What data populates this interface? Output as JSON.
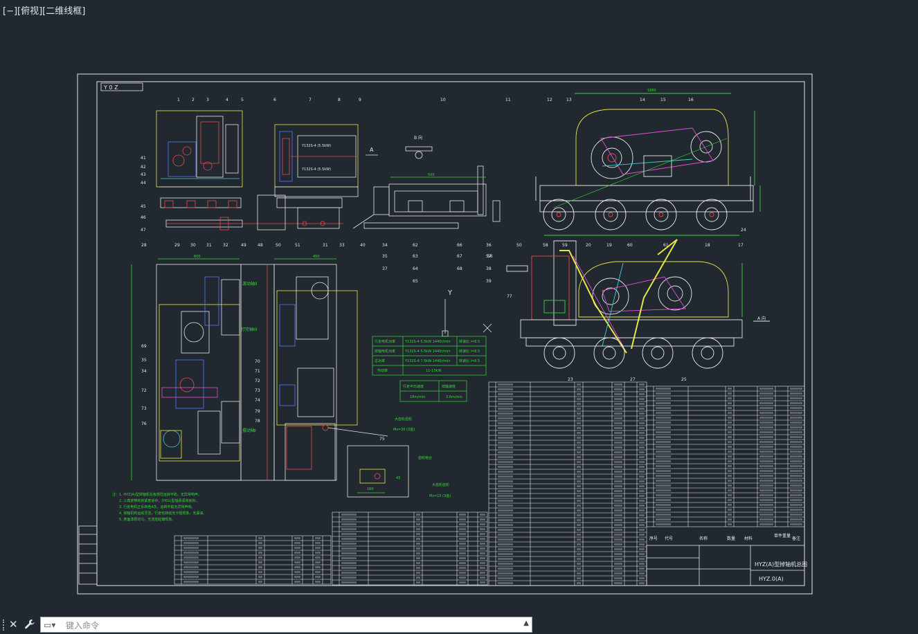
{
  "viewport": {
    "label": "[−][俯视][二维线框]",
    "background": "#212830"
  },
  "drawing": {
    "title": "HYZ(A)型掉轴机总图",
    "drawing_no": "HYZ.0(A)",
    "view_labels": {
      "top_left": "Y 0 Z",
      "section_b": "B 向",
      "view_a": "A 向",
      "view_a_arrow": "A"
    },
    "dims": {
      "d1": "575",
      "d2": "500",
      "d3": "1860",
      "d4": "120",
      "d5": "530",
      "d6": "188",
      "d7": "325",
      "d8": "710",
      "d9": "370",
      "d10": "600",
      "d11": "450",
      "d12": "1490",
      "d13": "160",
      "d14": "43",
      "d15": "800",
      "d16": "2540",
      "d17": "400"
    },
    "callouts_top": [
      "1",
      "2",
      "3",
      "4",
      "5",
      "6",
      "7",
      "8",
      "9",
      "10",
      "11",
      "12",
      "13",
      "14",
      "15",
      "16"
    ],
    "callouts_left": [
      "41",
      "42",
      "43",
      "44",
      "45",
      "46",
      "47"
    ],
    "callouts_bottom": [
      "28",
      "29",
      "30",
      "31",
      "32",
      "49",
      "48",
      "50",
      "51",
      "31",
      "33",
      "40",
      "34",
      "35",
      "37"
    ],
    "callouts_mid": [
      "62",
      "63",
      "64",
      "65",
      "66",
      "67",
      "68",
      "36",
      "57",
      "38",
      "39",
      "58",
      "59",
      "20",
      "19",
      "60",
      "61",
      "18",
      "17"
    ],
    "callouts_lower_left": [
      "69",
      "35",
      "34",
      "72",
      "73",
      "76"
    ],
    "callouts_lower_mid": [
      "70",
      "71",
      "72",
      "73",
      "74",
      "75",
      "79",
      "78"
    ],
    "callouts_right_lower": [
      "77",
      "50",
      "56",
      "23",
      "27",
      "25",
      "24"
    ],
    "green_labels": [
      "游动轴II",
      "打完轴III",
      "摆动轴I",
      "大齿轮齿轮",
      "齿轮啮合",
      "大齿轮齿轮"
    ],
    "motor_labels": [
      "Y132S-4 (5.5kW)",
      "1440r/min",
      "Y132S-4 (5.5kW)"
    ],
    "speed_table": {
      "rows": [
        [
          "行走电机功率",
          "Y132S-4 5.5kW 1440r/min",
          "转速比 i=8.5"
        ],
        [
          "掉轴电机功率",
          "Y132S-4 5.5kW 1440r/min",
          "转速比 i=8.5"
        ],
        [
          "总功率",
          "Y132S-4 7.5kW 1440r/min",
          "转速比 i=8.5"
        ],
        [
          "传动率",
          "11-13kW",
          ""
        ]
      ]
    },
    "speed_box": {
      "h1": "行走平均速度",
      "h2": "掉轴速度",
      "v1": "18m/min",
      "v2": "3.6m/min"
    },
    "notes": [
      "注：1. HYZ(A)型掉轴机在各部位运转平稳，无异常响声。",
      "2. 三角皮带的张紧度适中，(YKG)型轴承润滑良好。",
      "3. 行走电机正反转各4次，运转平稳无异常声响。",
      "4. 掉轴机构运动灵活，行走轮转动无卡阻现象，无漏油。",
      "5. 表面漆层均匀，无流挂起皱现象。"
    ],
    "table_header": [
      "序号",
      "代号",
      "名称",
      "数量",
      "材料",
      "单件重量",
      "总计重量",
      "备注"
    ],
    "small_text_a": "Ms=30 (3齿)",
    "small_text_b": "Ms=15 (3齿)"
  },
  "cmdline": {
    "close_icon": "close-icon",
    "settings_icon": "wrench-icon",
    "placeholder": "键入命令",
    "value": ""
  },
  "colors": {
    "background": "#212830",
    "line_white": "#e8e8e8",
    "green": "#3bd63b",
    "yellow": "#e6e64a",
    "magenta": "#e24fd8",
    "cyan": "#3fd0d0",
    "red": "#e84a4a",
    "blue": "#5577ff"
  }
}
